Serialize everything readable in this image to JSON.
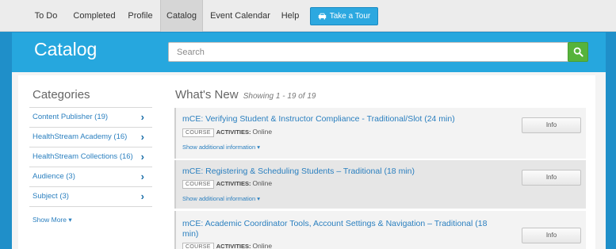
{
  "nav": {
    "items": [
      {
        "label": "To Do"
      },
      {
        "label": "Completed"
      },
      {
        "label": "Profile"
      },
      {
        "label": "Catalog",
        "active": true
      },
      {
        "label": "Event Calendar"
      },
      {
        "label": "Help"
      }
    ],
    "tour_label": "Take a Tour"
  },
  "page": {
    "title": "Catalog"
  },
  "search": {
    "placeholder": "Search",
    "value": ""
  },
  "sidebar": {
    "title": "Categories",
    "items": [
      {
        "label": "Content Publisher (19)"
      },
      {
        "label": "HealthStream Academy (16)"
      },
      {
        "label": "HealthStream Collections (16)"
      },
      {
        "label": "Audience (3)"
      },
      {
        "label": "Subject (3)"
      }
    ],
    "show_more": "Show More ▾"
  },
  "main": {
    "title": "What's New",
    "showing": "Showing 1 - 19 of 19",
    "courses": [
      {
        "title": "mCE: Verifying Student & Instructor Compliance - Traditional/Slot (24 min)",
        "badge": "COURSE",
        "activities_label": "ACTIVITIES:",
        "activities_value": "Online",
        "additional": "Show additional information ▾",
        "info_label": "Info"
      },
      {
        "title": "mCE: Registering & Scheduling Students – Traditional (18 min)",
        "badge": "COURSE",
        "activities_label": "ACTIVITIES:",
        "activities_value": "Online",
        "additional": "Show additional information ▾",
        "info_label": "Info"
      },
      {
        "title_line1": "mCE: Academic Coordinator Tools, Account Settings & Navigation – Traditional (18",
        "title_line2": "min)",
        "badge": "COURSE",
        "activities_label": "ACTIVITIES:",
        "activities_value": "Online",
        "info_label": "Info"
      }
    ]
  },
  "colors": {
    "brand_blue": "#26a7de",
    "search_green": "#56b33b",
    "link_blue": "#2a7fbf"
  },
  "icons": {
    "tour": "car-icon",
    "search": "search-icon",
    "category_chevron": "chevron-right-icon"
  }
}
